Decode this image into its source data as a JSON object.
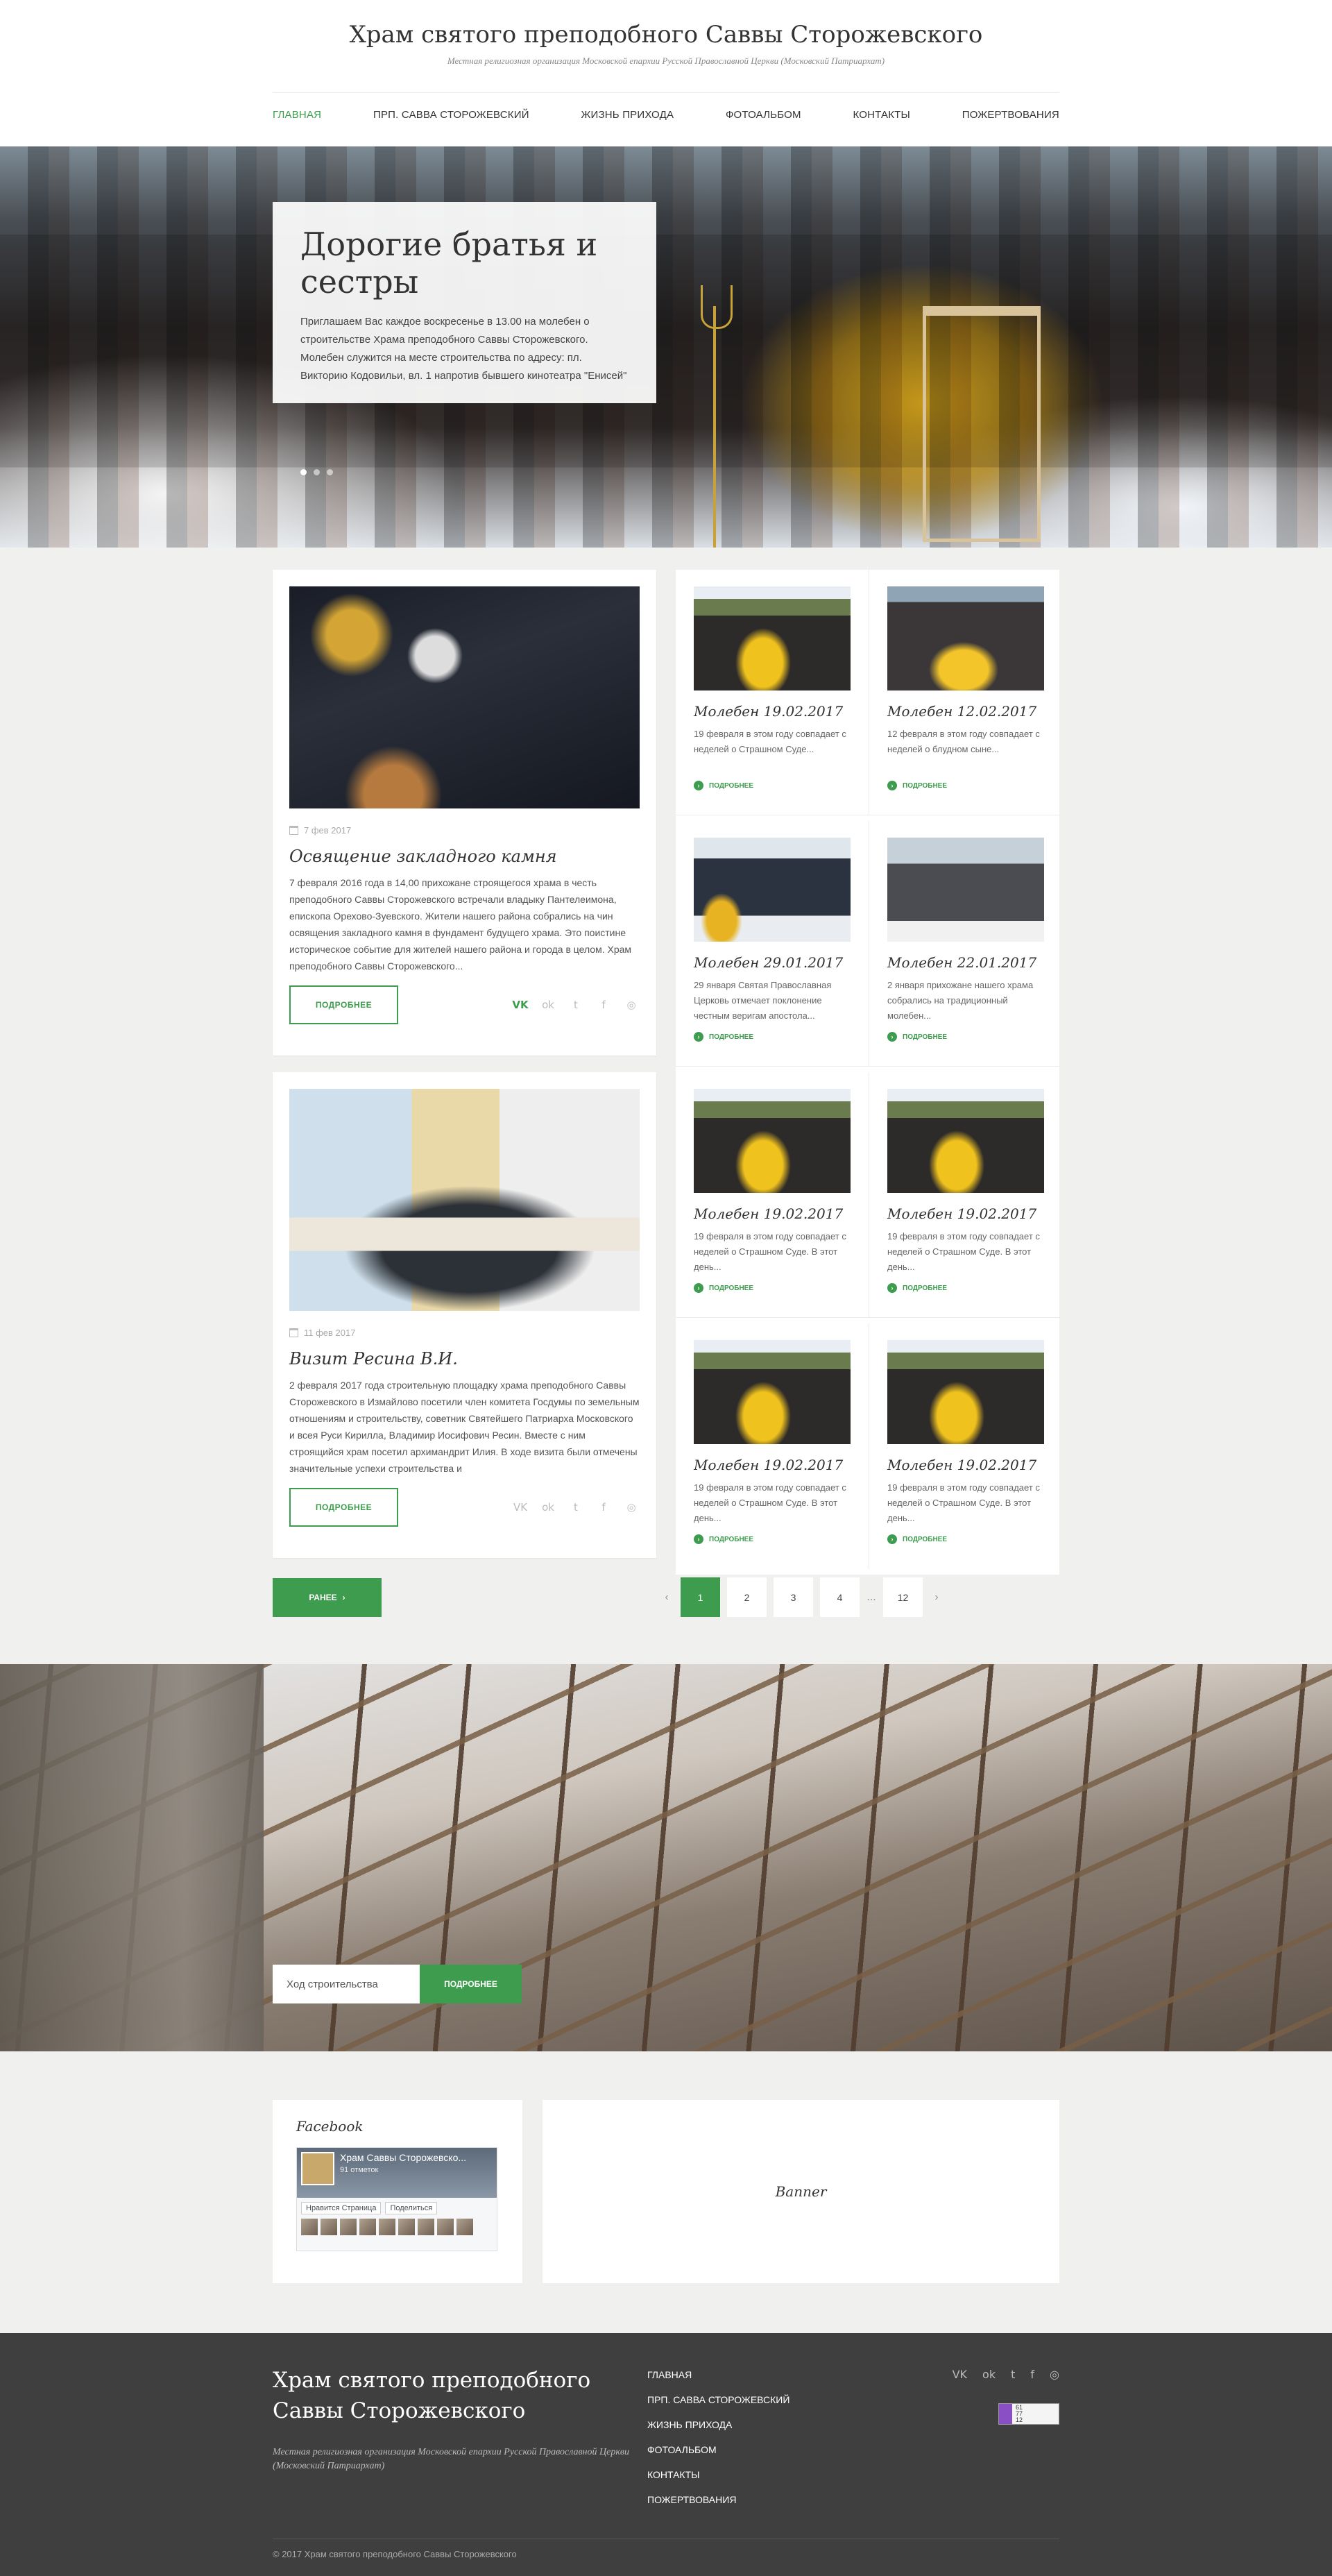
{
  "site": {
    "title": "Храм святого преподобного Саввы Сторожевского",
    "subtitle": "Местная религиозная организация Московской епархии Русской Православной Церкви (Московский Патриархат)"
  },
  "nav": {
    "items": [
      {
        "label": "Главная"
      },
      {
        "label": "Прп. Савва Сторожевский"
      },
      {
        "label": "Жизнь прихода"
      },
      {
        "label": "Фотоальбом"
      },
      {
        "label": "Контакты"
      },
      {
        "label": "Пожертвования"
      }
    ]
  },
  "hero": {
    "title": "Дорогие братья и сестры",
    "text": "Приглашаем Вас каждое воскресенье в 13.00 на молебен о строительстве Храма преподобного Саввы Сторожевского. Молебен служится на месте строительства по адресу: пл. Викторию Кодовильи, вл. 1 напротив бывшего кинотеатра \"Енисей\""
  },
  "posts": [
    {
      "date": "7 фев 2017",
      "title": "Освящение закладного камня",
      "text": "7 февраля 2016 года в 14,00 прихожане строящегося храма в честь преподобного Саввы Сторожевского встречали владыку Пантелеимона, епископа Орехово-Зуевского. Жители нашего района собрались на чин освящения закладного камня в фундамент будущего храма. Это поистине историческое событие для жителей нашего района и города в целом. Храм преподобного Саввы Сторожевского...",
      "button": "Подробнее"
    },
    {
      "date": "11 фев 2017",
      "title": "Визит Ресина В.И.",
      "text": "2 февраля 2017 года строительную площадку храма преподобного Саввы Сторожевского в Измайлово посетили член комитета Госдумы по земельным отношениям и строительству, советник Святейшего Патриарха Московского и всея Руси Кирилла, Владимир Иосифович Ресин. Вместе с ним строящийся храм посетил архимандрит Илия. В ходе визита были отмечены значительные успехи строительства и",
      "button": "Подробнее"
    }
  ],
  "social_glyphs": {
    "vk": "VK",
    "ok": "ok",
    "twitter": "t",
    "facebook": "f",
    "instagram": "◎"
  },
  "cards": [
    {
      "title": "Молебен 19.02.2017",
      "text": "19 февраля в этом году совпадает с неделей о Страшном Суде...",
      "more": "Подробнее"
    },
    {
      "title": "Молебен 12.02.2017",
      "text": "12 февраля в этом году совпадает с неделей о блудном сыне...",
      "more": "Подробнее"
    },
    {
      "title": "Молебен 29.01.2017",
      "text": "29 января Святая Православная Церковь отмечает поклонение честным веригам апостола...",
      "more": "Подробнее"
    },
    {
      "title": "Молебен 22.01.2017",
      "text": "2 января прихожане нашего храма собрались на традиционный молебен...",
      "more": "Подробнее"
    },
    {
      "title": "Молебен 19.02.2017",
      "text": "19 февраля в этом году совпадает с неделей о Страшном Суде. В этот день...",
      "more": "Подробнее"
    },
    {
      "title": "Молебен 19.02.2017",
      "text": "19 февраля в этом году совпадает с неделей о Страшном Суде. В этот день...",
      "more": "Подробнее"
    },
    {
      "title": "Молебен 19.02.2017",
      "text": "19 февраля в этом году совпадает с неделей о Страшном Суде. В этот день...",
      "more": "Подробнее"
    },
    {
      "title": "Молебен 19.02.2017",
      "text": "19 февраля в этом году совпадает с неделей о Страшном Суде. В этот день...",
      "more": "Подробнее"
    }
  ],
  "pagination": {
    "earlier": "Ранее",
    "pages": [
      "1",
      "2",
      "3",
      "4",
      "12"
    ],
    "current": "1",
    "ellipsis": "..."
  },
  "construction": {
    "input_value": "Ход строительства",
    "button": "Подробнее"
  },
  "facebook": {
    "heading": "Facebook",
    "page_name": "Храм Саввы Сторожевско...",
    "likes": "91 отметок",
    "like_button": "Нравится Страница",
    "share_button": "Поделиться"
  },
  "banner": {
    "label": "Banner"
  },
  "footer": {
    "title": "Храм святого преподобного Саввы Сторожевского",
    "subtitle": "Местная религиозная организация Московской епархии Русской Православной Церкви (Московский Патриархат)",
    "nav": [
      "Главная",
      "Прп. Савва Сторожевский",
      "Жизнь прихода",
      "Фотоальбом",
      "Контакты",
      "Пожертвования"
    ],
    "counter_lines": [
      "61",
      "77",
      "12"
    ],
    "copyright": "© 2017 Храм святого преподобного Саввы Сторожевского"
  },
  "colors": {
    "accent": "#3d9c4d",
    "footer_bg": "#3f3f3f",
    "page_bg": "#f0f0ef"
  }
}
